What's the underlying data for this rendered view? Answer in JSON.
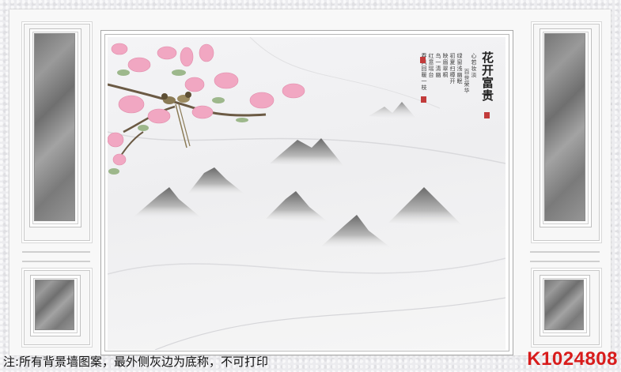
{
  "mural": {
    "title": "花开富贵",
    "poem_lines": [
      "心若妆淡",
      "百世荣华",
      "绿窗浅幽眠",
      "初夏扫樽开",
      "映眉翠桐",
      "鸟一清幽",
      "红意瑶台",
      "春风回暖一枝",
      "朵知后来",
      "盈室浅心",
      "只愿花开佳藏",
      "今岁繁华"
    ]
  },
  "footer": {
    "note": "注:所有背景墙图案，最外侧灰边为底称，不可打印",
    "code": "K1024808"
  },
  "colors": {
    "code_red": "#d81c1c",
    "panel_gray": "#8a8a8a",
    "blossom_pink": "#f1a7c2"
  }
}
